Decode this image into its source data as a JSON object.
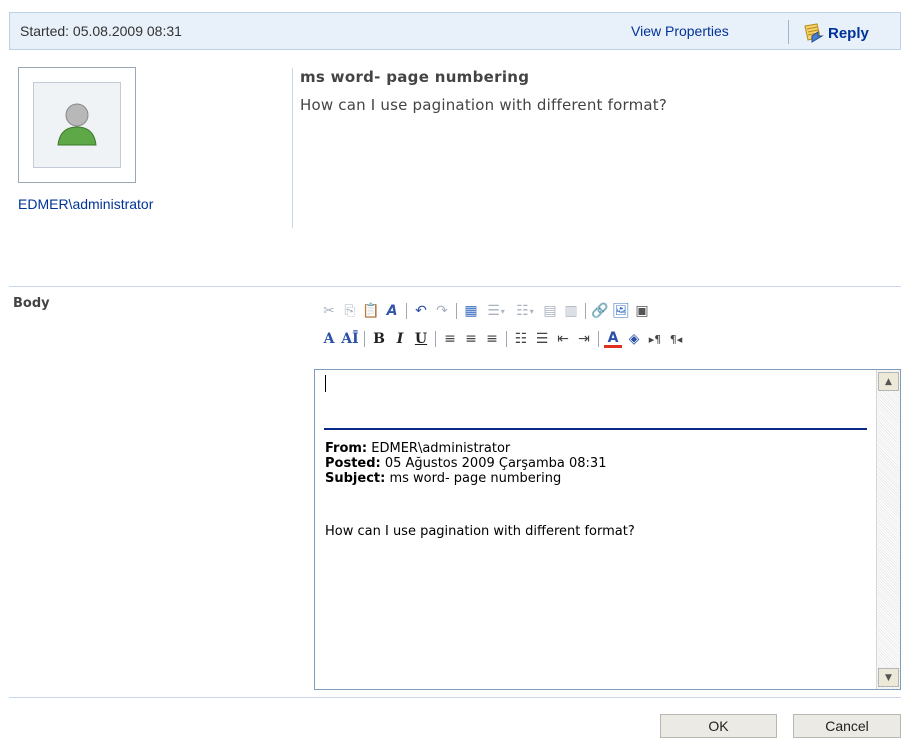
{
  "header": {
    "started": "Started: 05.08.2009 08:31",
    "view_properties": "View Properties",
    "reply": "Reply"
  },
  "author": {
    "name": "EDMER\\administrator",
    "avatar_icon": "user-avatar-icon"
  },
  "message": {
    "title": "ms word- page numbering",
    "text": "How can I use pagination with different format?"
  },
  "body_label": "Body",
  "toolbar": {
    "row2_labels": {
      "font": "A",
      "font_size": "AĪ",
      "bold": "B",
      "italic": "I",
      "underline": "U"
    }
  },
  "editor": {
    "from_label": "From:",
    "from_value": " EDMER\\administrator",
    "posted_label": "Posted:",
    "posted_value": " 05 Ağustos 2009 Çarşamba 08:31",
    "subject_label": "Subject:",
    "subject_value": " ms word- page numbering",
    "body_text": "How can I use pagination with different format?"
  },
  "buttons": {
    "ok": "OK",
    "cancel": "Cancel"
  },
  "colors": {
    "link": "#003399",
    "header_bg": "#e8f0f9",
    "rule": "#0a2a8a"
  }
}
